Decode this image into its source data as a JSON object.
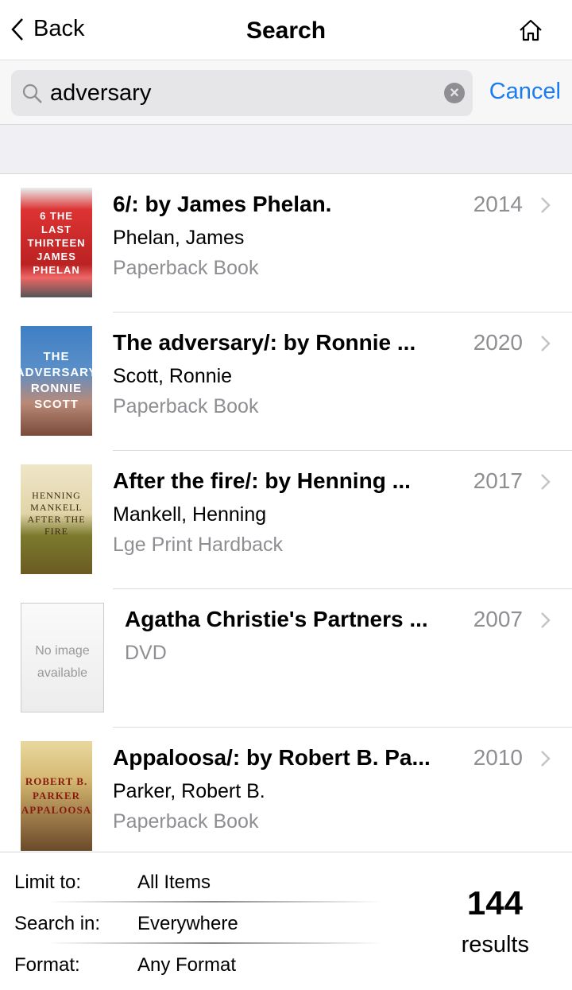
{
  "nav": {
    "back_label": "Back",
    "title": "Search",
    "home_icon": "home-icon"
  },
  "search": {
    "value": "adversary",
    "cancel_label": "Cancel"
  },
  "results": [
    {
      "title": "6/: by James Phelan.",
      "author": "Phelan, James",
      "format": "Paperback Book",
      "year": "2014",
      "cover_text": "6 THE LAST THIRTEEN JAMES PHELAN"
    },
    {
      "title": "The adversary/: by Ronnie ...",
      "author": "Scott, Ronnie",
      "format": "Paperback Book",
      "year": "2020",
      "cover_text": "THE ADVERSARY RONNIE SCOTT"
    },
    {
      "title": "After the fire/: by Henning ...",
      "author": "Mankell, Henning",
      "format": "Lge Print Hardback",
      "year": "2017",
      "cover_text": "HENNING MANKELL AFTER THE FIRE"
    },
    {
      "title": "Agatha Christie's Partners ...",
      "author": "",
      "format": "DVD",
      "year": "2007",
      "no_image": "No image available"
    },
    {
      "title": "Appaloosa/: by Robert B. Pa...",
      "author": "Parker, Robert B.",
      "format": "Paperback Book",
      "year": "2010",
      "cover_text": "ROBERT B. PARKER APPALOOSA"
    }
  ],
  "footer": {
    "limit_label": "Limit to:",
    "limit_value": "All Items",
    "search_in_label": "Search in:",
    "search_in_value": "Everywhere",
    "format_label": "Format:",
    "format_value": "Any Format",
    "count": "144",
    "count_label": "results"
  },
  "colors": {
    "accent": "#1a7bf2",
    "secondary_text": "#8e8e93"
  }
}
